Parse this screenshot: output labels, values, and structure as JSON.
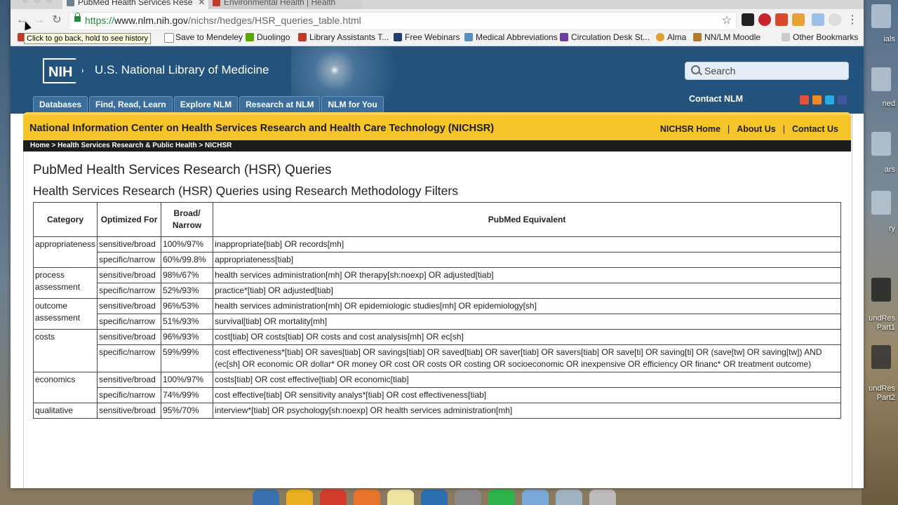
{
  "browser": {
    "tabs": [
      {
        "title": "PubMed Health Services Rese",
        "active": true
      },
      {
        "title": "Environmental Health | Health",
        "active": false
      }
    ],
    "url_scheme": "https://",
    "url_host": "www.nlm.nih.gov",
    "url_path": "/nichsr/hedges/HSR_queries_table.html",
    "back_tooltip": "Click to go back, hold to see history",
    "bookmarks": [
      {
        "label": "ail",
        "color": "#c0392b"
      },
      {
        "label": "Save to Mendeley",
        "color": "#888888"
      },
      {
        "label": "Duolingo",
        "color": "#58a700"
      },
      {
        "label": "Library Assistants T...",
        "color": "#c0392b"
      },
      {
        "label": "Free Webinars",
        "color": "#1e3c6e"
      },
      {
        "label": "Medical Abbreviations",
        "color": "#5a8fbf"
      },
      {
        "label": "Circulation Desk St...",
        "color": "#6a3fa0"
      },
      {
        "label": "Alma",
        "color": "#e0a030"
      },
      {
        "label": "NN/LM Moodle",
        "color": "#b07a30"
      },
      {
        "label": "Other Bookmarks",
        "color": "#999999"
      }
    ]
  },
  "nlm": {
    "logo": "NIH",
    "title": "U.S. National Library of Medicine",
    "search_placeholder": "Search",
    "nav": [
      "Databases",
      "Find, Read, Learn",
      "Explore NLM",
      "Research at NLM",
      "NLM for You"
    ],
    "contact": "Contact NLM"
  },
  "nichsr": {
    "title": "National Information Center on Health Services Research and Health Care Technology (NICHSR)",
    "links": [
      "NICHSR Home",
      "About Us",
      "Contact Us"
    ],
    "separator": "|",
    "breadcrumb": "Home > Health Services Research & Public Health > NICHSR"
  },
  "page": {
    "heading": "PubMed Health Services Research (HSR) Queries",
    "subheading": "Health Services Research (HSR) Queries using Research Methodology Filters"
  },
  "table": {
    "headers": [
      "Category",
      "Optimized For",
      "Broad/ Narrow",
      "PubMed Equivalent"
    ],
    "groups": [
      {
        "category": "appropriateness",
        "rows": [
          {
            "opt": "sensitive/broad",
            "bn": "100%/97%",
            "query": "inappropriate[tiab] OR records[mh]"
          },
          {
            "opt": "specific/narrow",
            "bn": "60%/99.8%",
            "query": "appropriateness[tiab]"
          }
        ]
      },
      {
        "category": "process assessment",
        "rows": [
          {
            "opt": "sensitive/broad",
            "bn": "98%/67%",
            "query": "health services administration[mh] OR therapy[sh:noexp] OR adjusted[tiab]"
          },
          {
            "opt": "specific/narrow",
            "bn": "52%/93%",
            "query": "practice*[tiab] OR adjusted[tiab]"
          }
        ]
      },
      {
        "category": "outcome assessment",
        "rows": [
          {
            "opt": "sensitive/broad",
            "bn": "96%/53%",
            "query": "health services administration[mh] OR epidemiologic studies[mh] OR epidemiology[sh]"
          },
          {
            "opt": "specific/narrow",
            "bn": "51%/93%",
            "query": "survival[tiab] OR mortality[mh]"
          }
        ]
      },
      {
        "category": "costs",
        "rows": [
          {
            "opt": "sensitive/broad",
            "bn": "96%/93%",
            "query": "cost[tiab] OR costs[tiab] OR costs and cost analysis[mh] OR ec[sh]"
          },
          {
            "opt": "specific/narrow",
            "bn": "59%/99%",
            "query": "cost effectiveness*[tiab] OR saves[tiab] OR savings[tiab] OR saved[tiab] OR saver[tiab] OR savers[tiab] OR save[ti] OR saving[ti] OR (save[tw] OR saving[tw]) AND (ec[sh] OR economic OR dollar* OR money OR cost OR costs OR costing OR socioeconomic OR inexpensive OR efficiency OR financ* OR treatment outcome)"
          }
        ]
      },
      {
        "category": "economics",
        "rows": [
          {
            "opt": "sensitive/broad",
            "bn": "100%/97%",
            "query": "costs[tiab] OR cost effective[tiab] OR economic[tiab]"
          },
          {
            "opt": "specific/narrow",
            "bn": "74%/99%",
            "query": "cost effective[tiab] OR sensitivity analys*[tiab] OR cost effectiveness[tiab]"
          }
        ]
      },
      {
        "category": "qualitative",
        "rows": [
          {
            "opt": "sensitive/broad",
            "bn": "95%/70%",
            "query": "interview*[tiab] OR psychology[sh:noexp] OR health services administration[mh]"
          }
        ]
      }
    ]
  },
  "desktop": {
    "labels": [
      "ials",
      "ned",
      "ars",
      "ry",
      "undRes Part1",
      "undRes Part2"
    ]
  }
}
